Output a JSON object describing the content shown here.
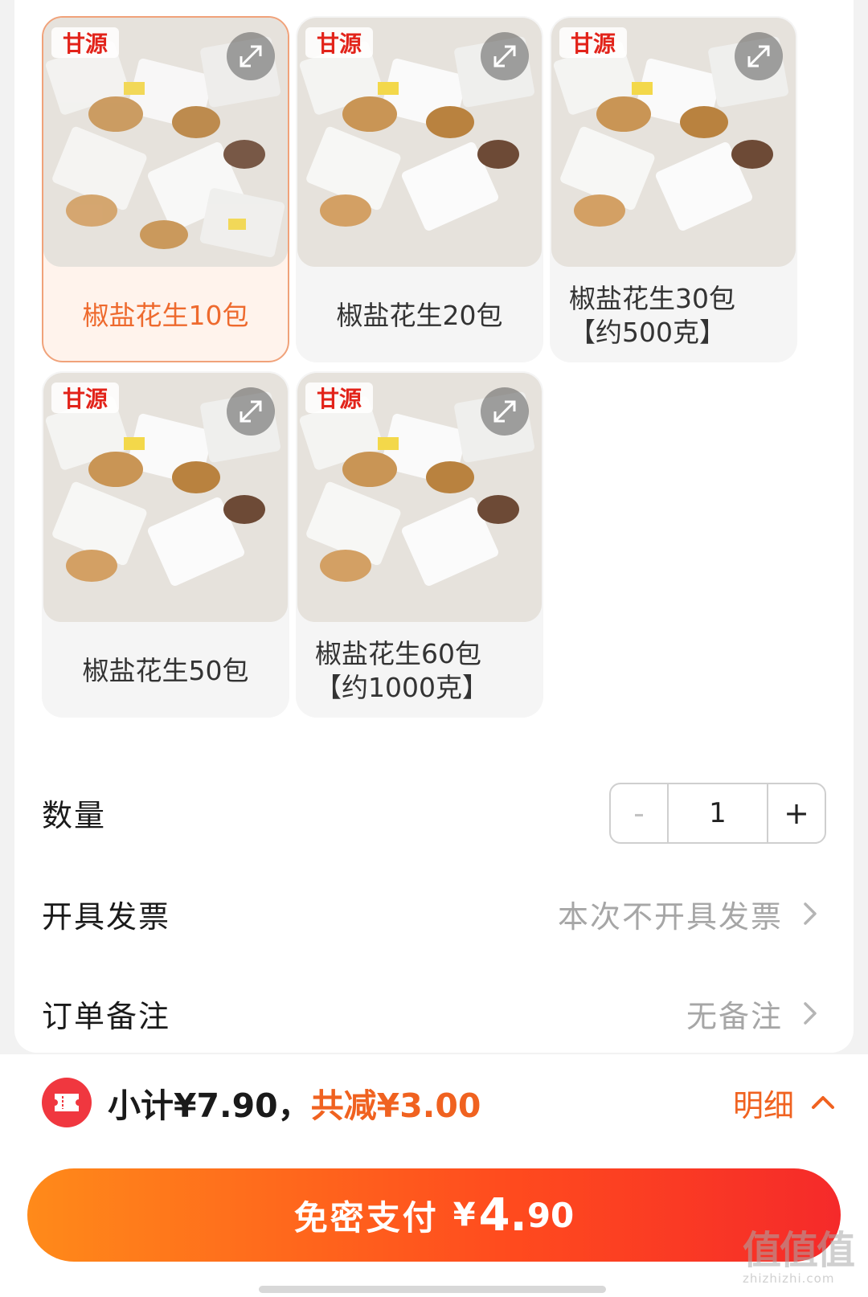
{
  "brand_logo_text": "甘源",
  "sku_options": [
    {
      "label": "椒盐花生10包",
      "selected": true
    },
    {
      "label": "椒盐花生20包",
      "selected": false
    },
    {
      "label": "椒盐花生30包【约500克】",
      "selected": false
    },
    {
      "label": "椒盐花生50包",
      "selected": false
    },
    {
      "label": "椒盐花生60包【约1000克】",
      "selected": false
    }
  ],
  "quantity": {
    "label": "数量",
    "minus": "-",
    "value": "1",
    "plus": "+"
  },
  "invoice": {
    "label": "开具发票",
    "value": "本次不开具发票"
  },
  "remark": {
    "label": "订单备注",
    "value": "无备注"
  },
  "summary": {
    "subtotal": "小计¥7.90，",
    "discount": "共减¥3.00",
    "detail_label": "明细"
  },
  "pay": {
    "label": "免密支付",
    "currency": "¥",
    "amount_int": "4.",
    "amount_dec": "90"
  },
  "watermark": {
    "big": "值值值",
    "small": "zhizhizhi.com"
  },
  "colors": {
    "accent": "#f06220",
    "selected_border": "#f0a27a",
    "pay_gradient_start": "#ff8a1a",
    "pay_gradient_end": "#f52a2a"
  }
}
